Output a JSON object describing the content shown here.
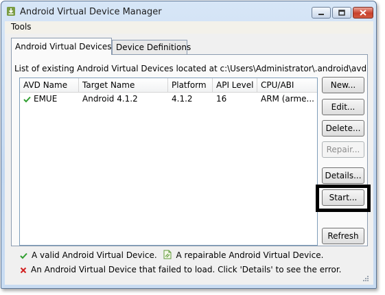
{
  "window": {
    "title": "Android Virtual Device Manager",
    "icon": "android-download-icon"
  },
  "menu": {
    "tools": "Tools"
  },
  "tabs": [
    {
      "label": "Android Virtual Devices",
      "active": true
    },
    {
      "label": "Device Definitions",
      "active": false
    }
  ],
  "description": "List of existing Android Virtual Devices located at c:\\Users\\Administrator\\.android\\avd",
  "table": {
    "columns": [
      "AVD Name",
      "Target Name",
      "Platform",
      "API Level",
      "CPU/ABI"
    ],
    "rows": [
      {
        "status_icon": "check-icon",
        "avd_name": "EMUE",
        "target": "Android 4.1.2",
        "platform": "4.1.2",
        "api_level": "16",
        "cpu_abi": "ARM (arme..."
      }
    ]
  },
  "buttons": {
    "new": "New...",
    "edit": "Edit...",
    "delete": "Delete...",
    "repair": "Repair...",
    "details": "Details...",
    "start": "Start...",
    "refresh": "Refresh"
  },
  "legend": {
    "valid": "A valid Android Virtual Device.",
    "repairable": "A repairable Android Virtual Device.",
    "failed": "An Android Virtual Device that failed to load. Click 'Details' to see the error."
  },
  "colors": {
    "valid_check": "#2e9e2e",
    "failed_x": "#d11f1f",
    "highlight": "#000000"
  }
}
